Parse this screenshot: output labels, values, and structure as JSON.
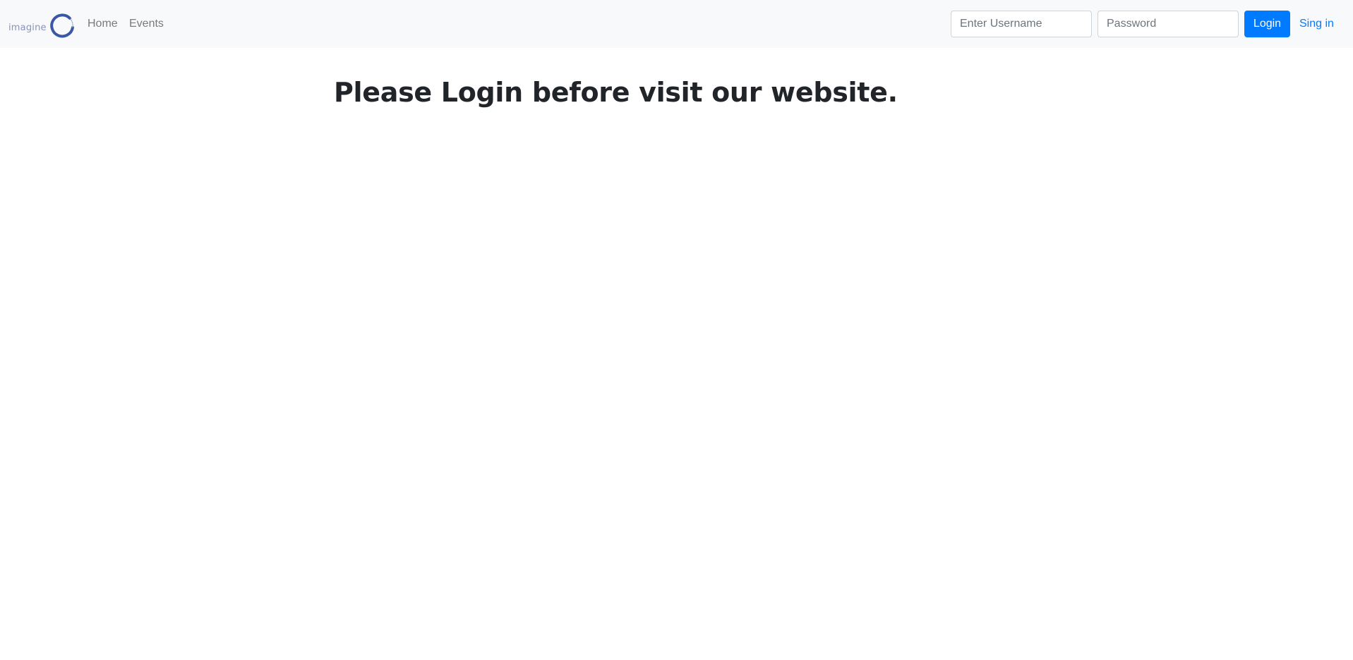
{
  "navbar": {
    "brand_text": "imagine",
    "links": [
      {
        "label": "Home"
      },
      {
        "label": "Events"
      }
    ],
    "username_placeholder": "Enter Username",
    "password_placeholder": "Password",
    "login_label": "Login",
    "signin_label": "Sing in"
  },
  "main": {
    "heading": "Please Login before visit our website."
  },
  "colors": {
    "navbar_bg": "#f8f9fa",
    "primary": "#007bff",
    "brand_ring": "#3a57a6",
    "heading_text": "#212529"
  }
}
